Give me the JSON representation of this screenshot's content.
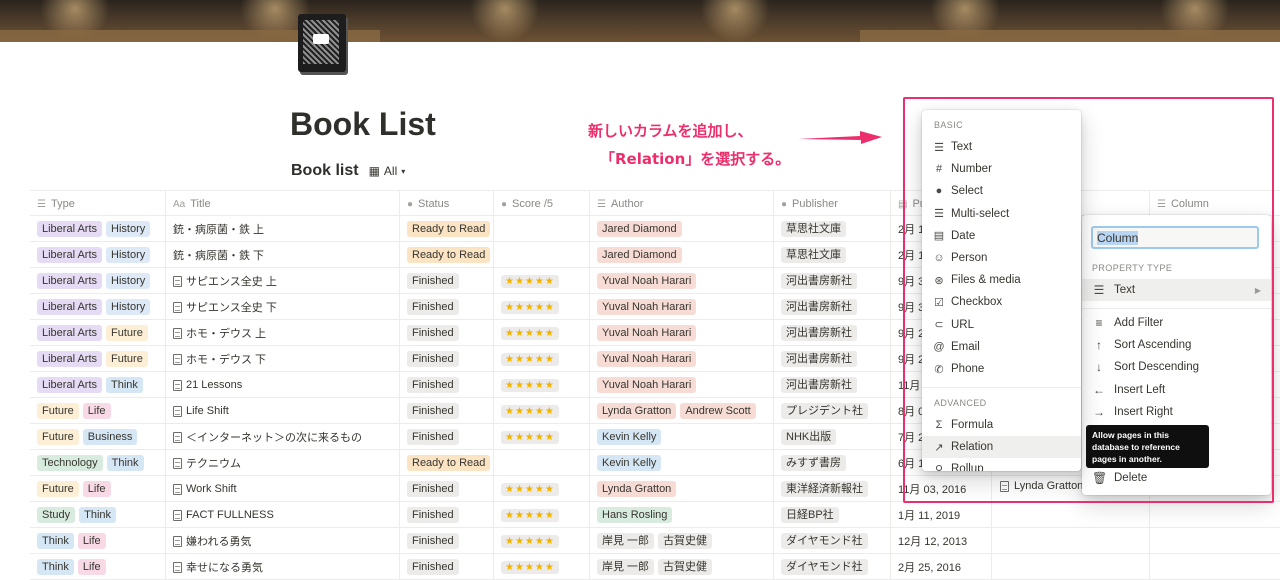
{
  "page": {
    "title": "Book List"
  },
  "view": {
    "title": "Book list",
    "view_label": "All"
  },
  "annotation": {
    "line1": "新しいカラムを追加し、",
    "line2": "「Relation」を選択する。"
  },
  "colors": {
    "accent": "#ec2f6c",
    "ready": "#fbe4c4",
    "finished": "#ecebe9"
  },
  "table": {
    "headers": {
      "type": "Type",
      "title": "Title",
      "status": "Status",
      "score": "Score /5",
      "author": "Author",
      "publisher": "Publisher",
      "published": "Pu",
      "column": "Column"
    },
    "rows": [
      {
        "tags": [
          "Liberal Arts",
          "History"
        ],
        "title": "銃・病原菌・鉄 上",
        "status": "Ready to Read",
        "score": "",
        "authors": [
          "Jared Diamond"
        ],
        "publisher": "草思社文庫",
        "date": "2月 1"
      },
      {
        "tags": [
          "Liberal Arts",
          "History"
        ],
        "title": "銃・病原菌・鉄 下",
        "status": "Ready to Read",
        "score": "",
        "authors": [
          "Jared Diamond"
        ],
        "publisher": "草思社文庫",
        "date": "2月 1"
      },
      {
        "tags": [
          "Liberal Arts",
          "History"
        ],
        "title": "サピエンス全史 上",
        "status": "Finished",
        "score": "★★★★★",
        "authors": [
          "Yuval Noah Harari"
        ],
        "publisher": "河出書房新社",
        "date": "9月 3"
      },
      {
        "tags": [
          "Liberal Arts",
          "History"
        ],
        "title": "サピエンス全史 下",
        "status": "Finished",
        "score": "★★★★★",
        "authors": [
          "Yuval Noah Harari"
        ],
        "publisher": "河出書房新社",
        "date": "9月 3"
      },
      {
        "tags": [
          "Liberal Arts",
          "Future"
        ],
        "title": "ホモ・デウス 上",
        "status": "Finished",
        "score": "★★★★★",
        "authors": [
          "Yuval Noah Harari"
        ],
        "publisher": "河出書房新社",
        "date": "9月 2"
      },
      {
        "tags": [
          "Liberal Arts",
          "Future"
        ],
        "title": "ホモ・デウス 下",
        "status": "Finished",
        "score": "★★★★★",
        "authors": [
          "Yuval Noah Harari"
        ],
        "publisher": "河出書房新社",
        "date": "9月 2"
      },
      {
        "tags": [
          "Liberal Arts",
          "Think"
        ],
        "title": "21 Lessons",
        "status": "Finished",
        "score": "★★★★★",
        "authors": [
          "Yuval Noah Harari"
        ],
        "publisher": "河出書房新社",
        "date": "11月"
      },
      {
        "tags": [
          "Future",
          "Life"
        ],
        "title": "Life Shift",
        "status": "Finished",
        "score": "★★★★★",
        "authors": [
          "Lynda Gratton",
          "Andrew Scott"
        ],
        "publisher": "プレジデント社",
        "date": "8月 0"
      },
      {
        "tags": [
          "Future",
          "Business"
        ],
        "title": "＜インターネット＞の次に来るもの",
        "status": "Finished",
        "score": "★★★★★",
        "authors": [
          "Kevin Kelly"
        ],
        "publisher": "NHK出版",
        "date": "7月 2"
      },
      {
        "tags": [
          "Technology",
          "Think"
        ],
        "title": "テクニウム",
        "status": "Ready to Read",
        "score": "",
        "authors": [
          "Kevin Kelly"
        ],
        "publisher": "みすず書房",
        "date": "6月 1"
      },
      {
        "tags": [
          "Future",
          "Life"
        ],
        "title": "Work Shift",
        "status": "Finished",
        "score": "★★★★★",
        "authors": [
          "Lynda Gratton"
        ],
        "publisher": "東洋経済新報社",
        "date": "11月 03, 2016"
      },
      {
        "tags": [
          "Study",
          "Think"
        ],
        "title": "FACT FULLNESS",
        "status": "Finished",
        "score": "★★★★★",
        "authors": [
          "Hans Rosling"
        ],
        "publisher": "日経BP社",
        "date": "1月 11, 2019"
      },
      {
        "tags": [
          "Think",
          "Life"
        ],
        "title": "嫌われる勇気",
        "status": "Finished",
        "score": "★★★★★",
        "authors": [
          "岸見 一郎",
          "古賀史健"
        ],
        "publisher": "ダイヤモンド社",
        "date": "12月 12, 2013"
      },
      {
        "tags": [
          "Think",
          "Life"
        ],
        "title": "幸せになる勇気",
        "status": "Finished",
        "score": "★★★★★",
        "authors": [
          "岸見 一郎",
          "古賀史健"
        ],
        "publisher": "ダイヤモンド社",
        "date": "2月 25, 2016"
      }
    ]
  },
  "menu": {
    "basic_label": "BASIC",
    "basic": [
      {
        "icon": "text-icon",
        "label": "Text"
      },
      {
        "icon": "number-icon",
        "label": "Number"
      },
      {
        "icon": "select-icon",
        "label": "Select"
      },
      {
        "icon": "multi-select-icon",
        "label": "Multi-select"
      },
      {
        "icon": "date-icon",
        "label": "Date"
      },
      {
        "icon": "person-icon",
        "label": "Person"
      },
      {
        "icon": "files-icon",
        "label": "Files & media"
      },
      {
        "icon": "checkbox-icon",
        "label": "Checkbox"
      },
      {
        "icon": "url-icon",
        "label": "URL"
      },
      {
        "icon": "email-icon",
        "label": "Email"
      },
      {
        "icon": "phone-icon",
        "label": "Phone"
      }
    ],
    "advanced_label": "ADVANCED",
    "advanced": [
      {
        "icon": "formula-icon",
        "label": "Formula"
      },
      {
        "icon": "relation-icon",
        "label": "Relation"
      },
      {
        "icon": "rollup-icon",
        "label": "Rollup"
      }
    ]
  },
  "panel": {
    "input_value": "Column",
    "property_type_label": "PROPERTY TYPE",
    "current_type": "Text",
    "actions": [
      {
        "icon": "filter-icon",
        "label": "Add Filter"
      },
      {
        "icon": "sort-ascending-icon",
        "label": "Sort Ascending"
      },
      {
        "icon": "sort-descending-icon",
        "label": "Sort Descending"
      },
      {
        "icon": "insert-left-icon",
        "label": "Insert Left"
      },
      {
        "icon": "insert-right-icon",
        "label": "Insert Right"
      }
    ],
    "delete_label": "Delete"
  },
  "tooltip": {
    "text": "Allow pages in this database to reference pages in another."
  },
  "partial_cell": {
    "text": "Lynda Gratton"
  }
}
